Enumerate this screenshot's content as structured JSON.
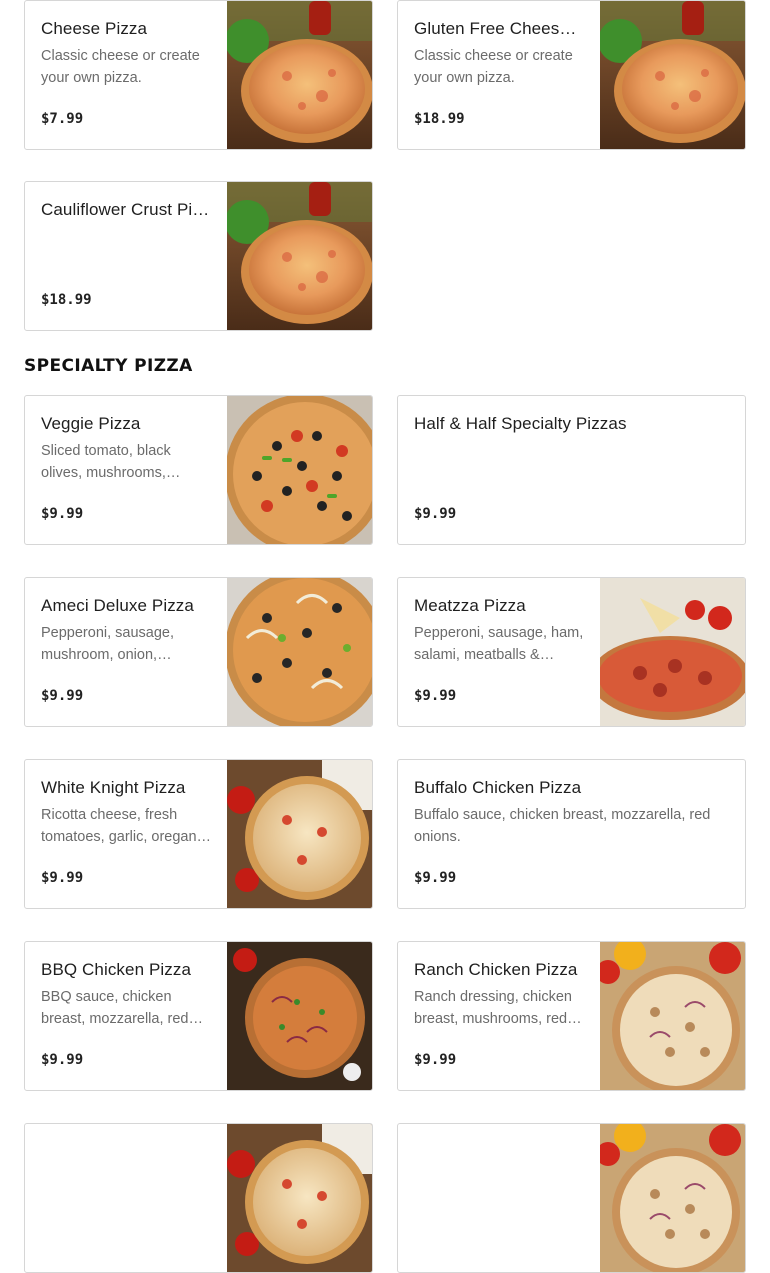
{
  "sections": [
    {
      "items": [
        {
          "name": "Cheese Pizza",
          "description": "Classic cheese or create your own pizza.",
          "price": "$7.99"
        },
        {
          "name": "Gluten Free Cheese…",
          "description": "Classic cheese or create your own pizza.",
          "price": "$18.99"
        },
        {
          "name": "Cauliflower Crust Pizza",
          "description": "",
          "price": "$18.99"
        }
      ]
    },
    {
      "title": "SPECIALTY PIZZA",
      "items": [
        {
          "name": "Veggie Pizza",
          "description": "Sliced tomato, black olives, mushrooms, gree…",
          "price": "$9.99"
        },
        {
          "name": "Half & Half Specialty Pizzas",
          "description": "",
          "price": "$9.99"
        },
        {
          "name": "Ameci Deluxe Pizza",
          "description": "Pepperoni, sausage, mushroom, onion, green…",
          "price": "$9.99"
        },
        {
          "name": "Meatzza Pizza",
          "description": "Pepperoni, sausage, ham, salami, meatballs &…",
          "price": "$9.99"
        },
        {
          "name": "White Knight Pizza",
          "description": "Ricotta cheese, fresh tomatoes, garlic, oregan…",
          "price": "$9.99"
        },
        {
          "name": "Buffalo Chicken Pizza",
          "description": "Buffalo sauce, chicken breast, mozzarella, red onions.",
          "price": "$9.99"
        },
        {
          "name": "BBQ Chicken Pizza",
          "description": "BBQ sauce, chicken breast, mozzarella, red…",
          "price": "$9.99"
        },
        {
          "name": "Ranch Chicken Pizza",
          "description": "Ranch dressing, chicken breast, mushrooms, red…",
          "price": "$9.99"
        }
      ]
    }
  ]
}
